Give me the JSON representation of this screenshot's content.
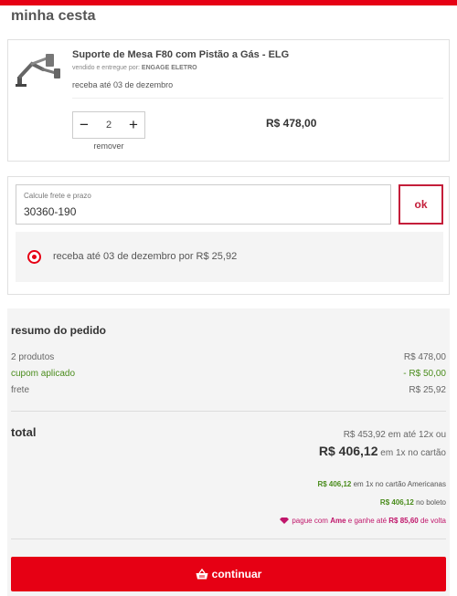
{
  "colors": {
    "brand": "#e60014",
    "accent_dark": "#c41e3a",
    "green": "#4a8c1c",
    "ame": "#c0166b"
  },
  "page_title": "minha cesta",
  "product": {
    "image_icon": "monitor-arm-thumbnail",
    "name": "Suporte de Mesa F80 com Pistão a Gás - ELG",
    "seller_prefix": "vendido e entregue por:",
    "seller_name": "ENGAGE ELETRO",
    "delivery": "receba até 03 de dezembro",
    "quantity": "2",
    "minus_label": "−",
    "plus_label": "+",
    "remove_label": "remover",
    "price": "R$ 478,00"
  },
  "shipping": {
    "zip_label": "Calcule frete e prazo",
    "zip_value": "30360-190",
    "ok_label": "ok",
    "option_text": "receba até 03 de dezembro por R$ 25,92",
    "option_selected": true
  },
  "summary": {
    "title": "resumo do pedido",
    "rows": [
      {
        "label": "2 produtos",
        "value": "R$ 478,00"
      },
      {
        "label": "cupom aplicado",
        "value": "- R$ 50,00"
      },
      {
        "label": "frete",
        "value": "R$ 25,92"
      }
    ],
    "total_label": "total",
    "installments_amount": "R$ 453,92",
    "installments_text": "em até 12x ou",
    "cash_amount": "R$ 406,12",
    "cash_text": "em 1x no cartão",
    "card_amount": "R$ 406,12",
    "card_text": "em 1x no cartão Americanas",
    "boleto_amount": "R$ 406,12",
    "boleto_text": "no boleto",
    "ame_prefix": "pague com",
    "ame_brand": "Ame",
    "ame_middle": "e ganhe até",
    "ame_cashback": "R$ 85,60",
    "ame_suffix": "de volta",
    "continue_label": "continuar"
  }
}
